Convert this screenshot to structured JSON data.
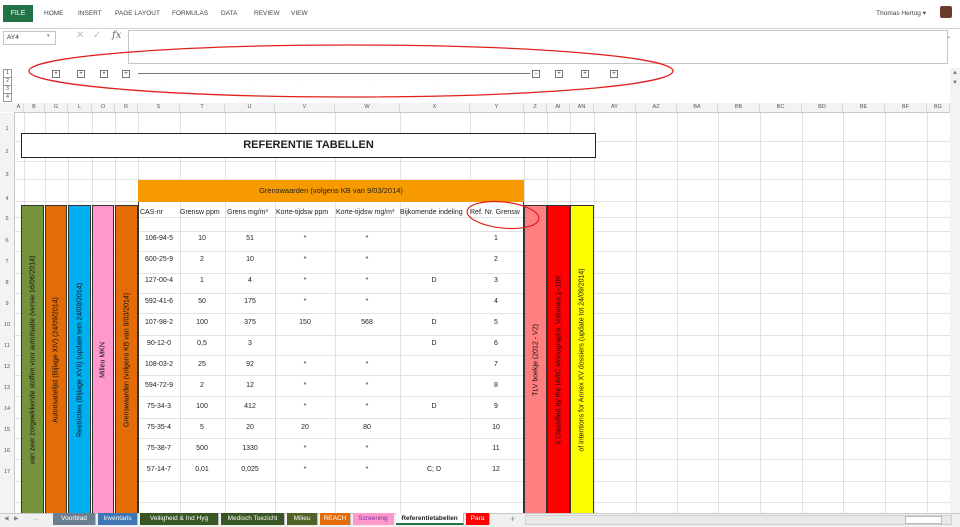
{
  "ribbon": {
    "file_label": "FILE",
    "tabs": [
      "HOME",
      "INSERT",
      "PAGE LAYOUT",
      "FORMULAS",
      "DATA",
      "REVIEW",
      "VIEW"
    ],
    "user_name": "Thomas Hertog",
    "user_menu_arrow": "▾"
  },
  "formula_bar": {
    "name_box": "AY4",
    "name_box_arrow": "▾",
    "cancel_icon": "✕",
    "enter_icon": "✓",
    "fx_label": "fx",
    "expand_icon": "⌄",
    "value": ""
  },
  "outline": {
    "levels": [
      "1",
      "2",
      "3",
      "4"
    ],
    "plus_symbol": "+",
    "minus_symbol": "−",
    "dot_symbol": "·"
  },
  "columns": [
    "A",
    "B",
    "G",
    "L",
    "O",
    "R",
    "S",
    "T",
    "U",
    "V",
    "W",
    "X",
    "Y",
    "Z",
    "AI",
    "AN",
    "AY",
    "AZ",
    "BA",
    "BB",
    "BC",
    "BD",
    "BE",
    "BF",
    "BG"
  ],
  "rows": [
    "1",
    "2",
    "3",
    "4",
    "5",
    "6",
    "7",
    "8",
    "9",
    "10",
    "11",
    "12",
    "13",
    "14",
    "15",
    "16",
    "17"
  ],
  "sheet": {
    "title": "REFERENTIE TABELLEN",
    "grens_header": "Grenswaarden (volgens KB van 9/03/2014)",
    "vertical_labels": [
      {
        "text": "van zeer zorgwekkende stoffen voor autorisatie (versie 16/06/2014)",
        "color": "#76923c"
      },
      {
        "text": "Autorisatielijst (Bijlage XIV) (24/09/2014)",
        "color": "#e36c09"
      },
      {
        "text": "Restricties (Bijlage XVII) (update tem 24/09/2014)",
        "color": "#00b0f0"
      },
      {
        "text": "Milieu MKN",
        "color": "#ff99cc"
      },
      {
        "text": "Grenswaarden (volgens KB van 9/03/2014)",
        "color": "#e36c09"
      },
      {
        "text": "TLV boekje (2012 - V2)",
        "color": "#ff7f7f"
      },
      {
        "text": "s Classified by the IARC Monographs, Volumes 1–106",
        "color": "#ff0000"
      },
      {
        "text": "of intentions for Annex XV dossiers (update tot 24/09/2014)",
        "color": "#ffff00"
      }
    ],
    "table_headers": [
      "CAS-nr",
      "Grensw ppm",
      "Grens mg/m³",
      "Korte-tijdsw ppm",
      "Korte-tijdsw mg/m³",
      "Bijkomende indeling",
      "Ref. Nr. Grensw"
    ],
    "table_rows": [
      [
        "106-94-5",
        "10",
        "51",
        "*",
        "*",
        "",
        "1"
      ],
      [
        "600-25-9",
        "2",
        "10",
        "*",
        "*",
        "",
        "2"
      ],
      [
        "127-00-4",
        "1",
        "4",
        "*",
        "*",
        "D",
        "3"
      ],
      [
        "592-41-6",
        "50",
        "175",
        "*",
        "*",
        "",
        "4"
      ],
      [
        "107-98-2",
        "100",
        "375",
        "150",
        "568",
        "D",
        "5"
      ],
      [
        "90-12-0",
        "0,5",
        "3",
        "",
        "",
        "D",
        "6"
      ],
      [
        "108-03-2",
        "25",
        "92",
        "*",
        "*",
        "",
        "7"
      ],
      [
        "594-72-9",
        "2",
        "12",
        "*",
        "*",
        "",
        "8"
      ],
      [
        "75-34-3",
        "100",
        "412",
        "*",
        "*",
        "D",
        "9"
      ],
      [
        "75-35-4",
        "5",
        "20",
        "20",
        "80",
        "",
        "10"
      ],
      [
        "75-38-7",
        "500",
        "1330",
        "*",
        "*",
        "",
        "11"
      ],
      [
        "57-14-7",
        "0,01",
        "0,025",
        "*",
        "*",
        "C; D",
        "12"
      ]
    ]
  },
  "sheet_tabs": [
    {
      "label": "Voorblad",
      "color": "#6d7f8f",
      "text_color": "#ffffff"
    },
    {
      "label": "Inventaris",
      "color": "#3f76b4",
      "text_color": "#ffffff"
    },
    {
      "label": "Veiligheid & Ind Hyg",
      "color": "#375623",
      "text_color": "#ffffff"
    },
    {
      "label": "Medisch Toezicht",
      "color": "#375623",
      "text_color": "#ffffff"
    },
    {
      "label": "Milieu",
      "color": "#4f6228",
      "text_color": "#ffffff"
    },
    {
      "label": "REACH",
      "color": "#e36c09",
      "text_color": "#ffffff"
    },
    {
      "label": "Screening",
      "color": "#ff99cc",
      "text_color": "#7030a0"
    },
    {
      "label": "Referentietabellen",
      "color": "#ffffff",
      "text_color": "#222222"
    },
    {
      "label": "Para",
      "color": "#ff0000",
      "text_color": "#ffffff"
    }
  ],
  "tab_nav": {
    "prev": "◀",
    "next": "▶",
    "more": "...",
    "add": "+"
  },
  "annotation_color": "#e0201c"
}
